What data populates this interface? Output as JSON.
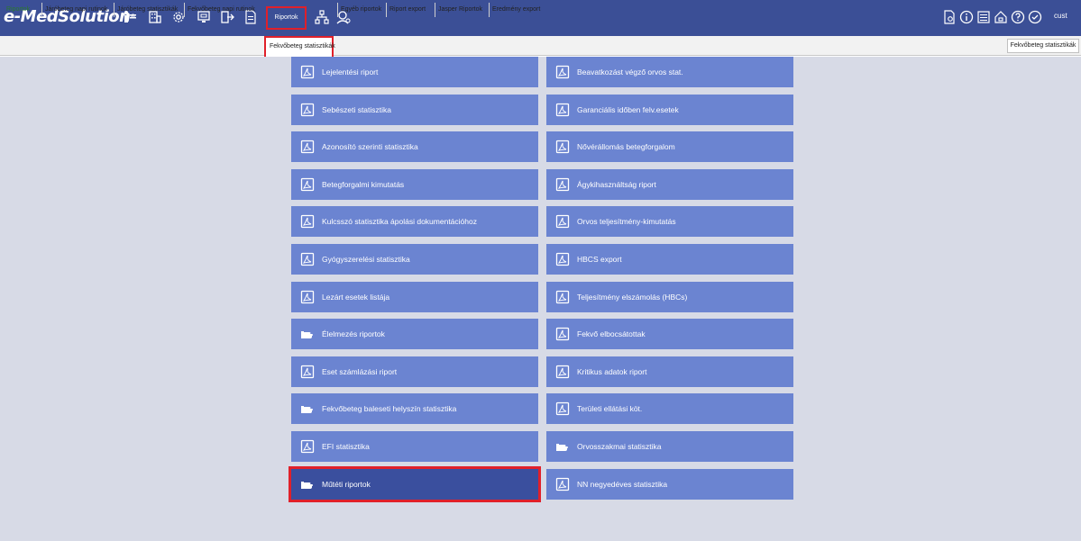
{
  "header": {
    "logo_text": "e-MedSolution",
    "logo_mark": "®",
    "nav_icons": [
      "patient-list-icon",
      "building-icon",
      "settings-gear-icon",
      "monitor-icon",
      "exit-door-icon",
      "document-icon"
    ],
    "active_menu": "Riportok",
    "after_icons": [
      "hierarchy-icon",
      "network-person-icon"
    ],
    "right_icons": [
      "report-search-icon",
      "info-circle-icon",
      "list-icon",
      "lock-icon",
      "help-circle-icon",
      "check-circle-icon"
    ],
    "user": "cust"
  },
  "tabs": {
    "items": [
      "Riportok",
      "Járóbeteg napi rutinok",
      "Járóbeteg statisztikák",
      "Fekvőbeteg napi rutinok",
      "Fekvőbeteg statisztikák",
      "Egyéb riportok",
      "Riport export",
      "Jasper Riportok",
      "Eredmény export"
    ],
    "active": "Fekvőbeteg statisztikák",
    "right_label": "Fekvőbeteg statisztikák"
  },
  "reports": {
    "left": [
      {
        "label": "Lejelentési riport",
        "icon": "pdf-icon"
      },
      {
        "label": "Sebészeti statisztika",
        "icon": "pdf-icon"
      },
      {
        "label": "Azonosító szerinti statisztika",
        "icon": "pdf-icon"
      },
      {
        "label": "Betegforgalmi kimutatás",
        "icon": "pdf-icon"
      },
      {
        "label": "Kulcsszó statisztika ápolási dokumentációhoz",
        "icon": "pdf-icon"
      },
      {
        "label": "Gyógyszerelési statisztika",
        "icon": "pdf-icon"
      },
      {
        "label": "Lezárt esetek listája",
        "icon": "pdf-icon"
      },
      {
        "label": "Élelmezés riportok",
        "icon": "pointing-hand-icon"
      },
      {
        "label": "Eset számlázási riport",
        "icon": "pdf-icon"
      },
      {
        "label": "Fekvőbeteg baleseti helyszín statisztika",
        "icon": "pointing-hand-icon"
      },
      {
        "label": "EFI statisztika",
        "icon": "pdf-icon"
      },
      {
        "label": "Műtéti riportok",
        "icon": "pointing-hand-icon",
        "active": true
      }
    ],
    "right": [
      {
        "label": "Beavatkozást végző orvos stat.",
        "icon": "pdf-icon"
      },
      {
        "label": "Garanciális időben felv.esetek",
        "icon": "pdf-icon"
      },
      {
        "label": "Nővérállomás betegforgalom",
        "icon": "pdf-icon"
      },
      {
        "label": "Ágykihasználtság riport",
        "icon": "pdf-icon"
      },
      {
        "label": "Orvos teljesítmény-kimutatás",
        "icon": "pdf-icon"
      },
      {
        "label": "HBCS export",
        "icon": "pdf-icon"
      },
      {
        "label": "Teljesítmény elszámolás (HBCs)",
        "icon": "pdf-icon"
      },
      {
        "label": "Fekvő elbocsátottak",
        "icon": "pdf-icon"
      },
      {
        "label": "Kritikus adatok riport",
        "icon": "pdf-icon"
      },
      {
        "label": "Területi ellátási köt.",
        "icon": "pdf-icon"
      },
      {
        "label": "Orvosszakmai statisztika",
        "icon": "pointing-hand-icon"
      },
      {
        "label": "NN negyedéves statisztika",
        "icon": "pdf-icon"
      }
    ]
  },
  "colors": {
    "header_bg": "#3b4f96",
    "button_bg": "#6b84d1",
    "button_active_bg": "#3a4f9e",
    "highlight": "#e0202a",
    "main_bg": "#d7dae6"
  }
}
